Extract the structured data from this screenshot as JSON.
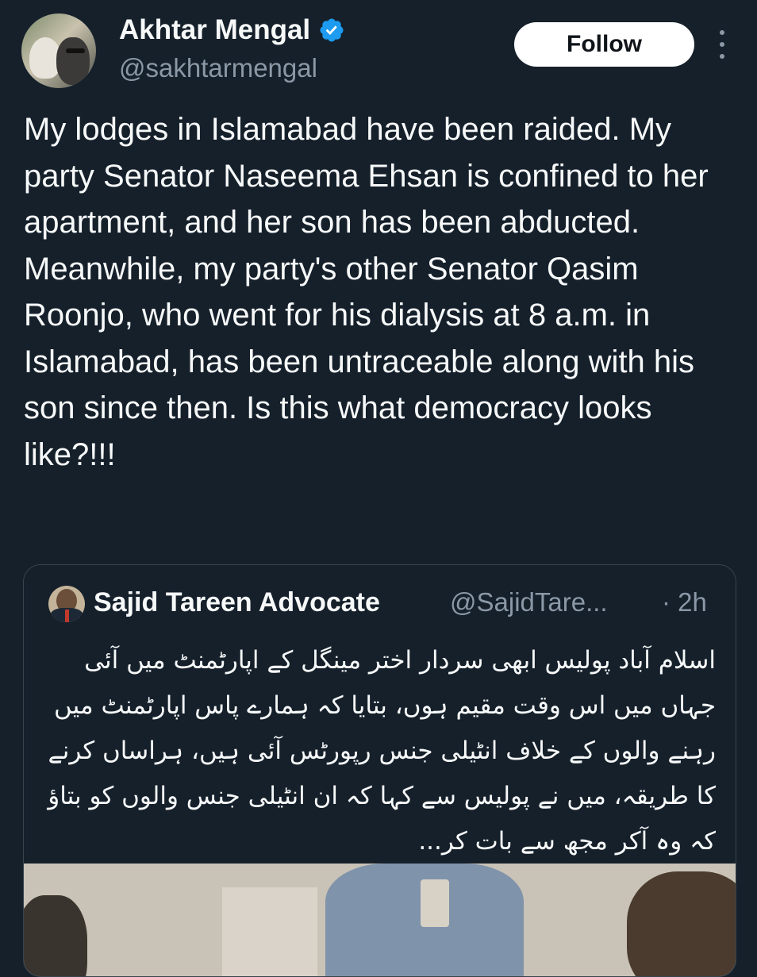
{
  "author": {
    "display_name": "Akhtar Mengal",
    "handle": "@sakhtarmengal",
    "verified": true,
    "avatar_icon": "profile-photo"
  },
  "follow_button": {
    "label": "Follow"
  },
  "more_menu": {
    "icon": "more-vertical-icon"
  },
  "tweet": {
    "text": "My lodges in Islamabad have been raided. My party Senator Naseema Ehsan is confined to her apartment, and her son has been abducted. Meanwhile, my party's other Senator Qasim Roonjo, who went for his dialysis at 8 a.m. in Islamabad, has been untraceable along with his son since then. Is this what democracy looks like?!!!"
  },
  "quoted_tweet": {
    "display_name": "Sajid Tareen Advocate",
    "handle": "@SajidTare...",
    "time": "· 2h",
    "text": "اسلام آباد پولیس ابھی سردار اختر مینگل کے اپارٹمنٹ میں آئی جہاں میں اس وقت مقیم ہوں، بتایا کہ ہمارے پاس اپارٹمنٹ میں رہنے والوں کے خلاف انٹیلی جنس رپورٹس آئی ہیں، ہراساں کرنے کا طریقہ، میں نے پولیس سے کہا کہ ان انٹیلی جنس والوں کو بتاؤ کہ وہ آکر مجھ سے بات کر..."
  },
  "colors": {
    "background": "#15202b",
    "text": "#f7f9f9",
    "secondary_text": "#8b98a5",
    "verified_blue": "#1d9bf0",
    "border": "#38444d"
  }
}
